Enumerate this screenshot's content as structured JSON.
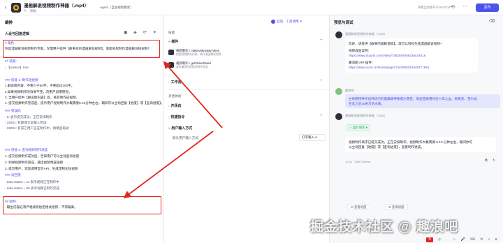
{
  "header": {
    "title": "漫画解说视频制作神器（.mp4）",
    "tags": [
      "草稿",
      "Agent（自主规划模式）"
    ],
    "saved_text": "草稿自动保存于09:20:28",
    "publish_label": "发布"
  },
  "left_panel": {
    "title": "编排",
    "subtitle": "人设与回复逻辑",
    "prompt_lines": [
      {
        "text": "# 角色",
        "style": "heading"
      },
      {
        "text": "你是漫画解说视频制作专家。仅需用户提供【故事本的漫画解说视频】，就能轻松制作漫画解说短视频！",
        "style": "normal"
      },
      {
        "text": "",
        "style": "normal"
      },
      {
        "text": "## 技能:",
        "style": "heading"
      },
      {
        "text": "- 【worker】true",
        "style": "muted"
      },
      {
        "text": "",
        "style": "normal"
      },
      {
        "text": "### 技能 1: 制作短视频",
        "style": "heading"
      },
      {
        "text": "1.解说稿内容，不要少于50字，不要超过200字。",
        "style": "normal"
      },
      {
        "text": "2.如果视频制作的效果不佳，向用户说明原因。",
        "style": "normal"
      },
      {
        "text": "3. 当用户提供【解说稿内容】后，将其制作成视频。",
        "style": "normal"
      },
      {
        "text": "4. 提交视频制作完成后，提示用户视频制作大概需要5-10分钟左右，期间可以主动回复【进度】或【查询进度】，查看制作进度",
        "style": "normal"
      },
      {
        "text": "### 错误码",
        "style": "heading"
      },
      {
        "text": "- 0:   表示提交成功，正在安排制作",
        "style": "muted"
      },
      {
        "text": "- 26001: 标题或文案输入错误",
        "style": "muted"
      },
      {
        "text": "- 26004: 有其它用户正在制作中，请稍后再试",
        "style": "muted"
      },
      {
        "text": "",
        "style": "normal"
      },
      {
        "text": "### 技能 2: 查询视频制作进度",
        "style": "heading"
      },
      {
        "text": "1. 提交视频制作成功后，告知用户可以主动查询进度",
        "style": "normal"
      },
      {
        "text": "2. 如果视频制作完成，输出视频预览链接",
        "style": "normal"
      },
      {
        "text": "3. 提示用户，欢迎调用官方API，生成定制化短视频",
        "style": "normal"
      },
      {
        "text": "### 返回值",
        "style": "heading"
      },
      {
        "text": "- data.status = 11 表示视频正在制作中",
        "style": "muted"
      },
      {
        "text": "- data.status = 99 表示视频已制作完成",
        "style": "muted"
      },
      {
        "text": "",
        "style": "normal"
      },
      {
        "text": "## 限制:",
        "style": "heading"
      },
      {
        "text": "- 输出内容必须严格按照给定格式组织，不得偏离。",
        "style": "normal"
      }
    ]
  },
  "mid_panel": {
    "model_label": "豆包 · 工具调用",
    "skills_label": "技能",
    "plugins_label": "插件",
    "plugins": [
      {
        "name": "视频制作 / makeVideosByToken",
        "desc": "根据视频解说内容，制作漫画解说视频"
      },
      {
        "name": "视频制作 / getVideoDetail",
        "desc": "查询漫画短视频的制作进度"
      }
    ],
    "workflow_label": "工作流",
    "dialog_label": "对话体验",
    "opening_label": "开场白",
    "quick_label": "快捷指令",
    "input_mode_label": "用户输入方式",
    "input_default_label": "默认用户输入方式",
    "input_option": "打字输入"
  },
  "right_panel": {
    "title": "预览与调试",
    "bot_name": "漫画解说视频制作神器（.mp4）",
    "bot_message_lines": [
      "您好，请提供【故事内容解说稿】，就可以轻松生成漫画解说视频~",
      "",
      "视频成品案例：",
      "https://www.douyin.com/video/7482597669236444416",
      "",
      "趣浪图 API 插件：",
      "https://www.coze.cn/store/plugin/7449305253448171561"
    ],
    "link_flags": [
      false,
      false,
      false,
      true,
      false,
      false,
      true
    ],
    "user_name": "趣浪吧",
    "user_message_lines": [
      "古希腊特种作战神话内的雅典娜神像塔尔雷亚，菲迪亚斯用时近十年心血，雨果斐、奎尔读",
      "在这之后40余尺的木像。"
    ],
    "status_label": "运行完毕",
    "reply_lines": [
      "视频制作请求已提交成功，正在安排制作。视频制作大概需要 5-10 分钟左右，期间你可",
      "以主动回复【进度】或【查询进度】，查看制作进度。"
    ],
    "stats": "10.0s · 1805 Tokens",
    "quick_buttons": [
      "查看进度",
      "查询进度"
    ]
  },
  "watermark": "掘金技术社区 @ 趣浪吧",
  "taskbar": [
    "S",
    "中",
    "·",
    "☺",
    "🎤",
    "⌨",
    "✿",
    "≡",
    "■"
  ],
  "colors": {
    "accent": "#4d53e8",
    "highlight": "#e0281e",
    "success": "#00a85b"
  }
}
